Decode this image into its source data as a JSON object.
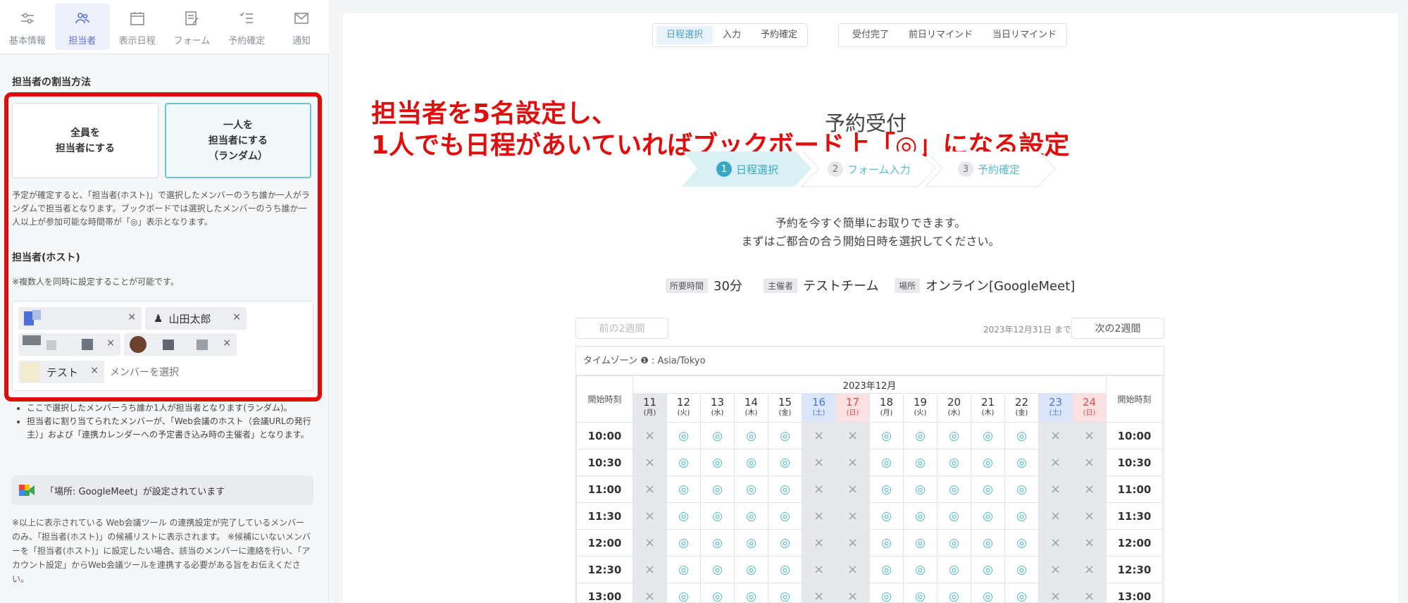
{
  "sidebar": {
    "tabs": [
      {
        "label": "基本情報",
        "icon": "sliders-icon"
      },
      {
        "label": "担当者",
        "icon": "users-icon"
      },
      {
        "label": "表示日程",
        "icon": "calendar-icon"
      },
      {
        "label": "フォーム",
        "icon": "form-icon"
      },
      {
        "label": "予約確定",
        "icon": "checklist-icon"
      },
      {
        "label": "通知",
        "icon": "mail-icon"
      }
    ],
    "assign_title": "担当者の割当方法",
    "option_all": "全員を\n担当者にする",
    "option_one": "一人を\n担当者にする\n（ランダム）",
    "assign_note": "予定が確定すると、「担当者(ホスト)」で選択したメンバーのうち誰か一人がランダムで担当者となります。ブックボードでは選択したメンバーのうち誰か一人以上が参加可能な時間帯が「◎」表示となります。",
    "host_title": "担当者(ホスト)",
    "host_note": "※複数人を同時に設定することが可能です。",
    "chip_yamada": "山田太郎",
    "chip_test": "テスト",
    "chip_close": "×",
    "member_placeholder": "メンバーを選択",
    "bullet1": "ここで選択したメンバーうち誰か1人が担当者となります(ランダム)。",
    "bullet2": "担当者に割り当てられたメンバーが、「Web会議のホスト（会議URLの発行主）」および「連携カレンダーへの予定書き込み時の主催者」となります。",
    "gmeet_text": "「場所: GoogleMeet」が設定されています",
    "footer_note": "※以上に表示されている Web会議ツール の連携設定が完了しているメンバーのみ、「担当者(ホスト)」の候補リストに表示されます。 ※候補にいないメンバーを「担当者(ホスト)」に設定したい場合、該当のメンバーに連絡を行い、「アカウント設定」からWeb会議ツールを連携する必要がある旨をお伝えください。"
  },
  "main": {
    "step_tabs_a": [
      "日程選択",
      "入力",
      "予約確定"
    ],
    "step_tabs_b": [
      "受付完了",
      "前日リマインド",
      "当日リマインド"
    ],
    "page_title": "予約受付",
    "annotation_line1": "担当者を5名設定し、",
    "annotation_line2": "1人でも日程があいていればブックボード上「◎」になる設定",
    "steps": [
      {
        "num": "1",
        "label": "日程選択"
      },
      {
        "num": "2",
        "label": "フォーム入力"
      },
      {
        "num": "3",
        "label": "予約確定"
      }
    ],
    "desc1": "予約を今すぐ簡単にお取りできます。",
    "desc2": "まずはご都合の合う開始日時を選択してください。",
    "duration_tag": "所要時間",
    "duration": "30分",
    "organizer_tag": "主催者",
    "organizer": "テストチーム",
    "place_tag": "場所",
    "place": "オンライン[GoogleMeet]",
    "prev_btn": "前の2週間",
    "next_btn": "次の2週間",
    "until": "2023年12月31日 まで",
    "timezone": "タイムゾーン ❶ : Asia/Tokyo",
    "month": "2023年12月",
    "start_col": "開始時刻",
    "days": [
      {
        "d": "11",
        "w": "(月)",
        "kind": "gray"
      },
      {
        "d": "12",
        "w": "(火)",
        "kind": ""
      },
      {
        "d": "13",
        "w": "(水)",
        "kind": ""
      },
      {
        "d": "14",
        "w": "(木)",
        "kind": ""
      },
      {
        "d": "15",
        "w": "(金)",
        "kind": ""
      },
      {
        "d": "16",
        "w": "(土)",
        "kind": "sat"
      },
      {
        "d": "17",
        "w": "(日)",
        "kind": "sun"
      },
      {
        "d": "18",
        "w": "(月)",
        "kind": ""
      },
      {
        "d": "19",
        "w": "(火)",
        "kind": ""
      },
      {
        "d": "20",
        "w": "(水)",
        "kind": ""
      },
      {
        "d": "21",
        "w": "(木)",
        "kind": ""
      },
      {
        "d": "22",
        "w": "(金)",
        "kind": ""
      },
      {
        "d": "23",
        "w": "(土)",
        "kind": "sat"
      },
      {
        "d": "24",
        "w": "(日)",
        "kind": "sun"
      }
    ],
    "times": [
      "10:00",
      "10:30",
      "11:00",
      "11:30",
      "12:00",
      "12:30",
      "13:00"
    ],
    "slot_pattern": [
      "×",
      "◎",
      "◎",
      "◎",
      "◎",
      "×",
      "×",
      "◎",
      "◎",
      "◎",
      "◎",
      "◎",
      "×",
      "×"
    ]
  }
}
